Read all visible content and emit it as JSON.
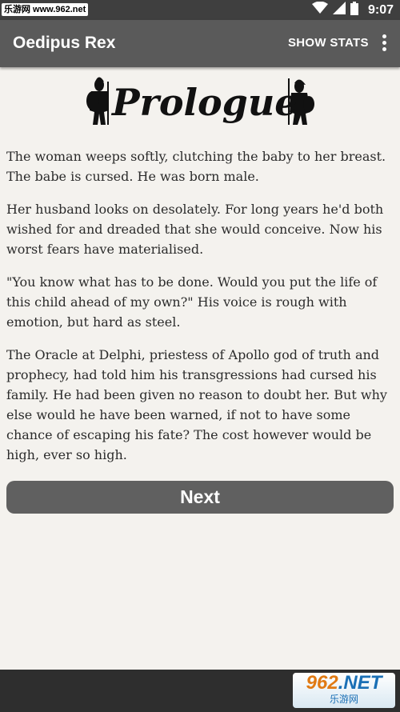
{
  "status_bar": {
    "watermark": "乐游网 www.962.net",
    "time": "9:07"
  },
  "app_bar": {
    "title": "Oedipus Rex",
    "show_stats_label": "SHOW STATS",
    "overflow_icon": "more-vert-icon"
  },
  "header": {
    "title_text": "Prologue"
  },
  "story": {
    "paragraphs": [
      "The woman weeps softly, clutching the baby to her breast. The babe is cursed. He was born male.",
      "Her husband looks on desolately. For long years he'd both wished for and dreaded that she would conceive. Now his worst fears have materialised.",
      "\"You know what has to be done. Would you put the life of this child ahead of my own?\" His voice is rough with emotion, but hard as steel.",
      "The Oracle at Delphi, priestess of Apollo god of truth and prophecy, had told him his transgressions had cursed his family. He had been given no reason to doubt her. But why else would he have been warned, if not to have some chance of escaping his fate? The cost however would be high, ever so high."
    ]
  },
  "next_label": "Next",
  "nav_watermark": {
    "main_a": "962",
    "main_b": ".NET",
    "sub": "乐游网"
  },
  "colors": {
    "app_bar": "#5a5a5a",
    "status_bar": "#3f3f3f",
    "page_bg": "#f4f2ee",
    "button": "#606060"
  }
}
